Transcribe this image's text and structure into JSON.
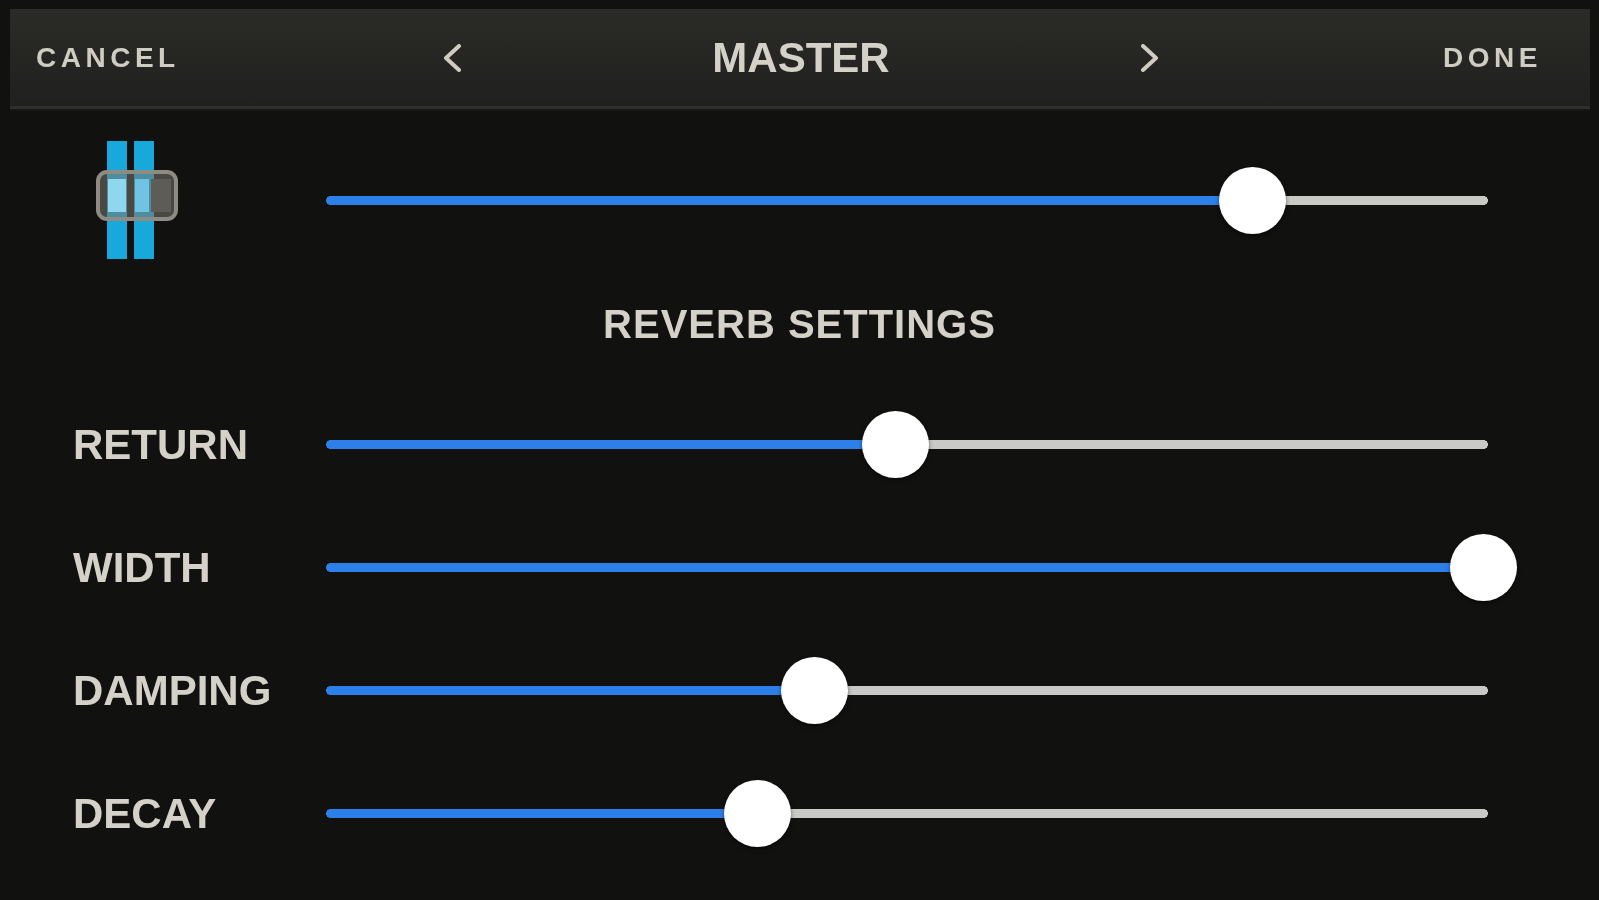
{
  "header": {
    "cancel": "CANCEL",
    "title": "MASTER",
    "done": "DONE"
  },
  "master_slider": {
    "level": 0.8
  },
  "section_title": "REVERB SETTINGS",
  "sliders": [
    {
      "label": "RETURN",
      "level": 0.49
    },
    {
      "label": "WIDTH",
      "level": 1
    },
    {
      "label": "DAMPING",
      "level": 0.42
    },
    {
      "label": "DECAY",
      "level": 0.37
    }
  ]
}
